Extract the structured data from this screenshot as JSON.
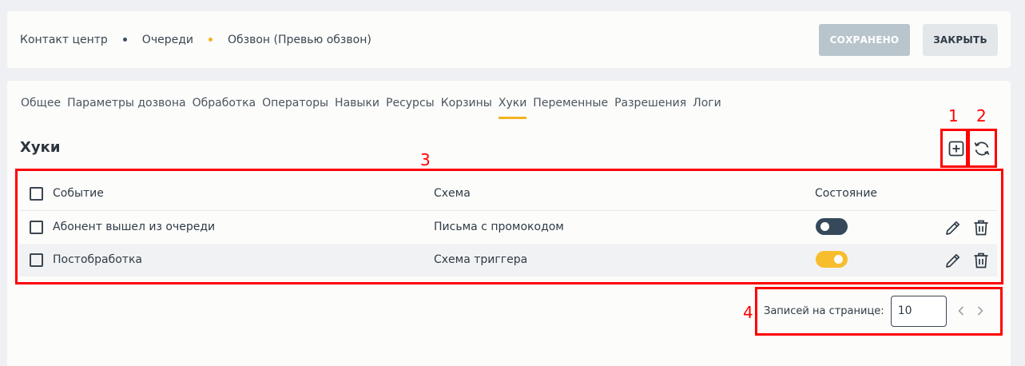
{
  "breadcrumb": {
    "items": [
      "Контакт центр",
      "Очереди",
      "Обзвон (Превью обзвон)"
    ],
    "dot_colors": [
      "#3a4f60",
      "#f5b21f"
    ]
  },
  "header": {
    "saved_label": "СОХРАНЕНО",
    "close_label": "ЗАКРЫТЬ"
  },
  "tabs": [
    {
      "label": "Общее"
    },
    {
      "label": "Параметры дозвона"
    },
    {
      "label": "Обработка"
    },
    {
      "label": "Операторы"
    },
    {
      "label": "Навыки"
    },
    {
      "label": "Ресурсы"
    },
    {
      "label": "Корзины"
    },
    {
      "label": "Хуки",
      "active": true
    },
    {
      "label": "Переменные"
    },
    {
      "label": "Разрешения"
    },
    {
      "label": "Логи"
    }
  ],
  "section": {
    "title": "Хуки"
  },
  "toolbar": {
    "add_icon": "plus-square-icon",
    "refresh_icon": "refresh-icon"
  },
  "table": {
    "columns": [
      "Событие",
      "Схема",
      "Состояние"
    ],
    "rows": [
      {
        "event": "Абонент вышел из очереди",
        "scheme": "Письма с промокодом",
        "enabled": false
      },
      {
        "event": "Постобработка",
        "scheme": "Схема триггера",
        "enabled": true
      }
    ]
  },
  "pagination": {
    "label": "Записей на странице:",
    "per_page": "10"
  },
  "annotations": {
    "labels": [
      "1",
      "2",
      "3",
      "4"
    ],
    "color": "#ff0000"
  },
  "colors": {
    "accent": "#f5b21f",
    "toggle_off": "#35495a",
    "toggle_on": "#f8bd2d"
  }
}
